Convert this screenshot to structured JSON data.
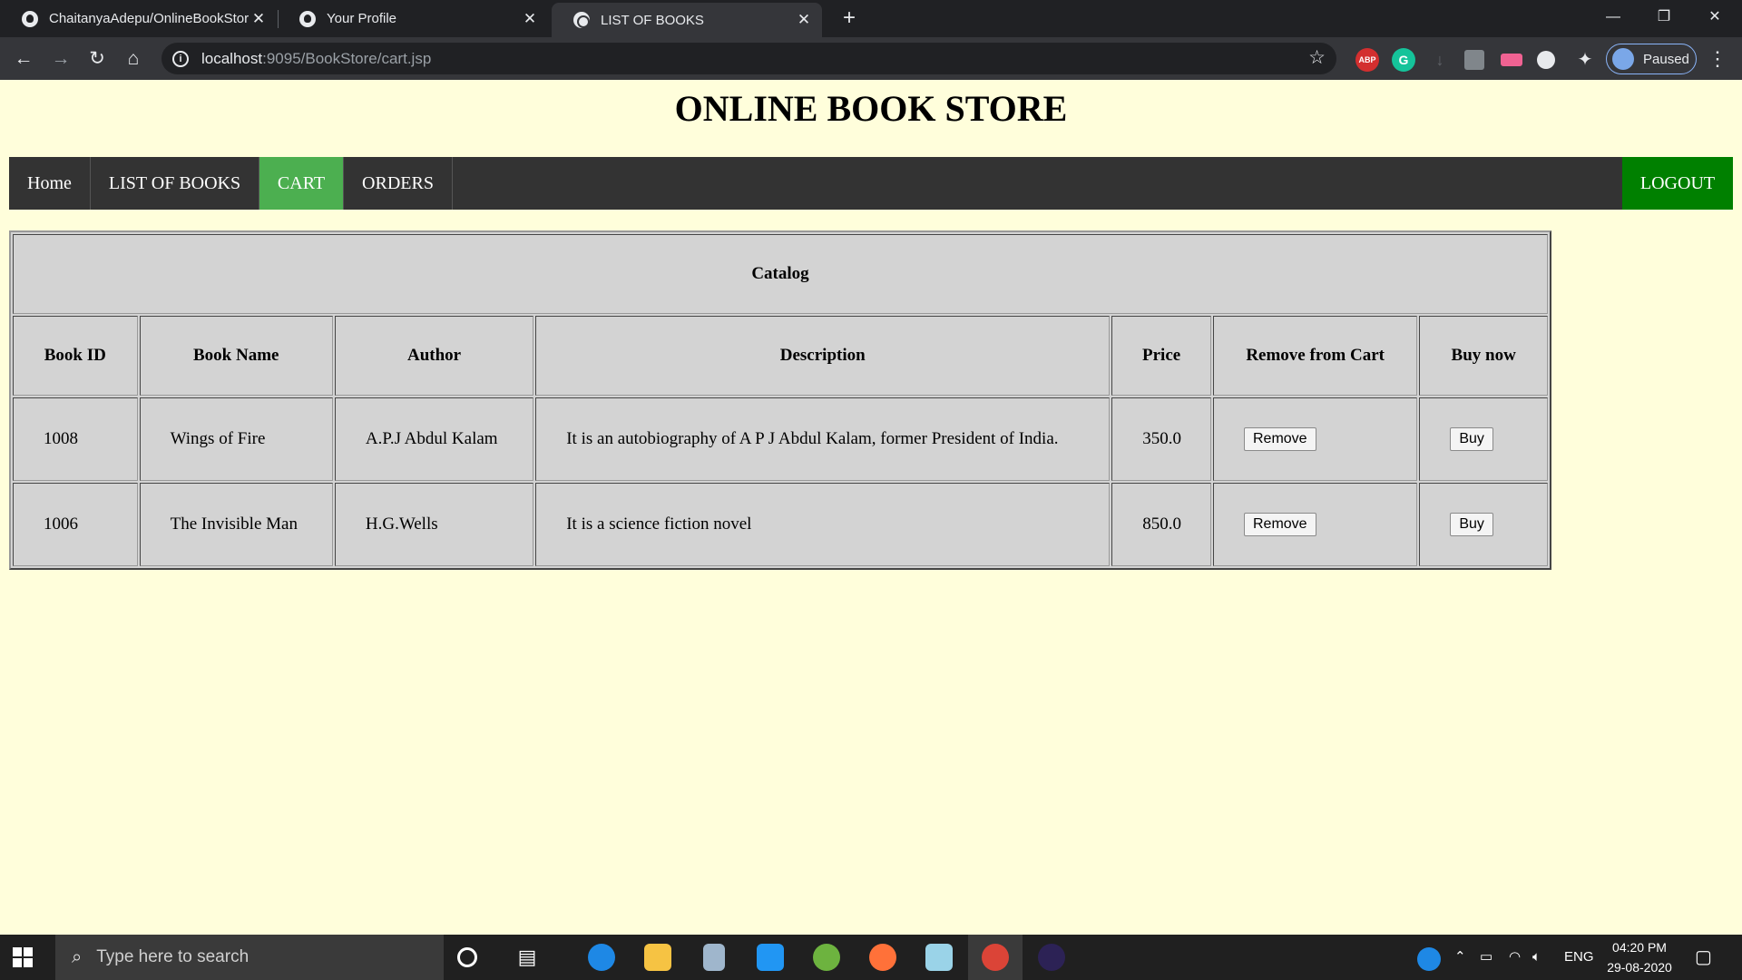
{
  "browser": {
    "tabs": [
      {
        "title": "ChaitanyaAdepu/OnlineBookStor",
        "active": false
      },
      {
        "title": "Your Profile",
        "active": false
      },
      {
        "title": "LIST OF BOOKS",
        "active": true
      }
    ],
    "close_glyph": "✕",
    "new_tab_glyph": "+",
    "url_host": "localhost",
    "url_path": ":9095/BookStore/cart.jsp",
    "profile_status": "Paused",
    "extensions": [
      "ABP",
      "G"
    ]
  },
  "page": {
    "title": "ONLINE BOOK STORE",
    "nav": {
      "home": "Home",
      "list_of_books": "LIST OF BOOKS",
      "cart": "CART",
      "orders": "ORDERS",
      "logout": "LOGOUT"
    },
    "table": {
      "caption": "Catalog",
      "headers": [
        "Book ID",
        "Book Name",
        "Author",
        "Description",
        "Price",
        "Remove from Cart",
        "Buy now"
      ],
      "rows": [
        {
          "id": "1008",
          "name": "Wings of Fire",
          "author": "A.P.J Abdul Kalam",
          "description": "It is an autobiography of A P J Abdul Kalam, former President of India.",
          "price": "350.0",
          "remove_label": "Remove",
          "buy_label": "Buy"
        },
        {
          "id": "1006",
          "name": "The Invisible Man",
          "author": "H.G.Wells",
          "description": "It is a science fiction novel",
          "price": "850.0",
          "remove_label": "Remove",
          "buy_label": "Buy"
        }
      ]
    }
  },
  "taskbar": {
    "search_placeholder": "Type here to search",
    "language": "ENG",
    "time": "04:20 PM",
    "date": "29-08-2020"
  },
  "colors": {
    "page_bg": "#fffedb",
    "nav_bg": "#333333",
    "nav_active": "#4caf50",
    "logout_bg": "#008000",
    "table_bg": "#d3d3d3"
  }
}
